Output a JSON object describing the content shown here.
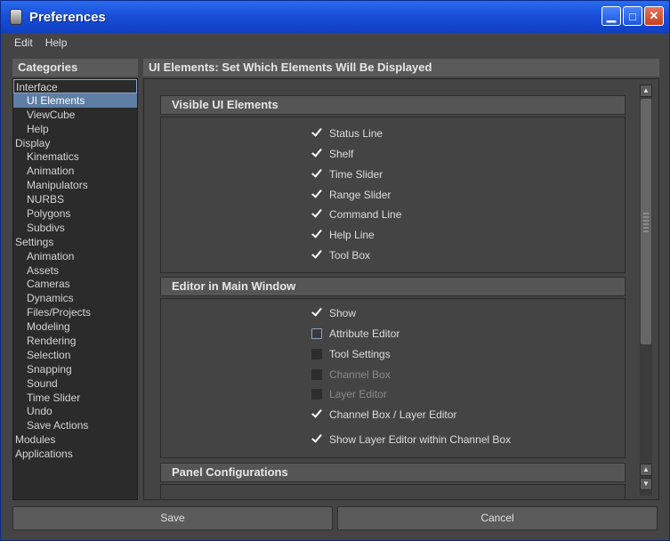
{
  "window": {
    "title": "Preferences"
  },
  "menu": {
    "items": [
      "Edit",
      "Help"
    ]
  },
  "sidebar": {
    "header": "Categories",
    "items": [
      {
        "label": "Interface",
        "level": 0
      },
      {
        "label": "UI Elements",
        "level": 1,
        "selected": true
      },
      {
        "label": "ViewCube",
        "level": 1
      },
      {
        "label": "Help",
        "level": 1
      },
      {
        "label": "Display",
        "level": 0
      },
      {
        "label": "Kinematics",
        "level": 1
      },
      {
        "label": "Animation",
        "level": 1
      },
      {
        "label": "Manipulators",
        "level": 1
      },
      {
        "label": "NURBS",
        "level": 1
      },
      {
        "label": "Polygons",
        "level": 1
      },
      {
        "label": "Subdivs",
        "level": 1
      },
      {
        "label": "Settings",
        "level": 0
      },
      {
        "label": "Animation",
        "level": 1
      },
      {
        "label": "Assets",
        "level": 1
      },
      {
        "label": "Cameras",
        "level": 1
      },
      {
        "label": "Dynamics",
        "level": 1
      },
      {
        "label": "Files/Projects",
        "level": 1
      },
      {
        "label": "Modeling",
        "level": 1
      },
      {
        "label": "Rendering",
        "level": 1
      },
      {
        "label": "Selection",
        "level": 1
      },
      {
        "label": "Snapping",
        "level": 1
      },
      {
        "label": "Sound",
        "level": 1
      },
      {
        "label": "Time Slider",
        "level": 1
      },
      {
        "label": "Undo",
        "level": 1
      },
      {
        "label": "Save Actions",
        "level": 1
      },
      {
        "label": "Modules",
        "level": 0
      },
      {
        "label": "Applications",
        "level": 0
      }
    ]
  },
  "main": {
    "header": "UI Elements: Set Which Elements Will Be Displayed",
    "visible_ui": {
      "title": "Visible UI Elements",
      "items": [
        {
          "label": "Status Line",
          "checked": true
        },
        {
          "label": "Shelf",
          "checked": true
        },
        {
          "label": "Time Slider",
          "checked": true
        },
        {
          "label": "Range Slider",
          "checked": true
        },
        {
          "label": "Command Line",
          "checked": true
        },
        {
          "label": "Help Line",
          "checked": true
        },
        {
          "label": "Tool Box",
          "checked": true
        }
      ]
    },
    "editor_main": {
      "title": "Editor in Main Window",
      "items": [
        {
          "label": "Show",
          "state": "checked"
        },
        {
          "label": "Attribute Editor",
          "state": "empty"
        },
        {
          "label": "Tool Settings",
          "state": "dark"
        },
        {
          "label": "Channel Box",
          "state": "disabled"
        },
        {
          "label": "Layer Editor",
          "state": "disabled"
        },
        {
          "label": "Channel Box / Layer Editor",
          "state": "checked"
        },
        {
          "label": "Show Layer Editor within Channel Box",
          "state": "checked"
        }
      ]
    },
    "panel_config": {
      "title": "Panel Configurations"
    }
  },
  "footer": {
    "save": "Save",
    "cancel": "Cancel"
  }
}
